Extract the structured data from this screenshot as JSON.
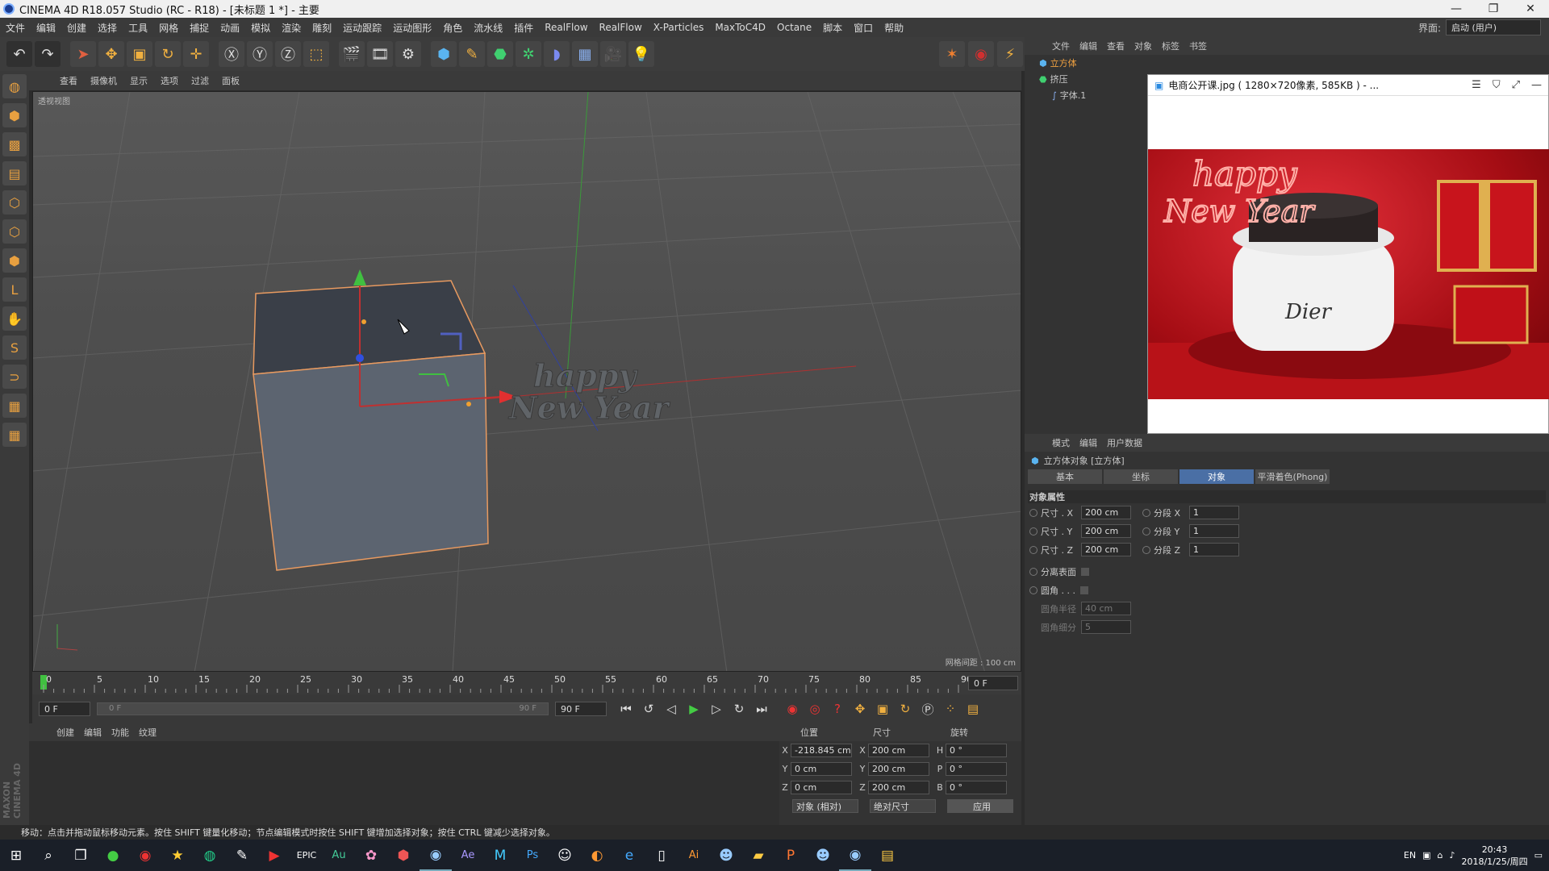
{
  "window": {
    "title": "CINEMA 4D R18.057 Studio (RC - R18) - [未标题 1 *] - 主要",
    "minimize": "—",
    "restore": "❐",
    "close": "✕"
  },
  "menu": {
    "items": [
      "文件",
      "编辑",
      "创建",
      "选择",
      "工具",
      "网格",
      "捕捉",
      "动画",
      "模拟",
      "渲染",
      "雕刻",
      "运动跟踪",
      "运动图形",
      "角色",
      "流水线",
      "插件",
      "RealFlow",
      "RealFlow",
      "X-Particles",
      "MaxToC4D",
      "Octane",
      "脚本",
      "窗口",
      "帮助"
    ],
    "layout_label": "界面:",
    "layout_value": "启动 (用户)"
  },
  "viewport": {
    "menu": [
      "查看",
      "摄像机",
      "显示",
      "选项",
      "过滤",
      "面板"
    ],
    "label": "透视视图",
    "grid_info": "网格间距 : 100 cm",
    "scene_text_1": "happy",
    "scene_text_2": "New Year"
  },
  "timeline": {
    "ticks": [
      "0",
      "5",
      "10",
      "15",
      "20",
      "25",
      "30",
      "35",
      "40",
      "45",
      "50",
      "55",
      "60",
      "65",
      "70",
      "75",
      "80",
      "85",
      "90"
    ],
    "current": "0 F",
    "start": "0 F",
    "range_start": "0 F",
    "range_end": "90 F",
    "end": "90 F"
  },
  "material": {
    "menu": [
      "创建",
      "编辑",
      "功能",
      "纹理"
    ],
    "maxon": "MAXON CINEMA 4D"
  },
  "coords": {
    "h_pos": "位置",
    "h_size": "尺寸",
    "h_rot": "旋转",
    "rows": [
      {
        "a": "X",
        "p": "-218.845 cm",
        "b": "X",
        "s": "200 cm",
        "c": "H",
        "r": "0 °"
      },
      {
        "a": "Y",
        "p": "0 cm",
        "b": "Y",
        "s": "200 cm",
        "c": "P",
        "r": "0 °"
      },
      {
        "a": "Z",
        "p": "0 cm",
        "b": "Z",
        "s": "200 cm",
        "c": "B",
        "r": "0 °"
      }
    ],
    "mode": "对象 (相对)",
    "size_mode": "绝对尺寸",
    "apply": "应用"
  },
  "status": "移动：点击并拖动鼠标移动元素。按住 SHIFT 键量化移动；节点编辑模式时按住 SHIFT 键增加选择对象；按住 CTRL 键减少选择对象。",
  "objects": {
    "menu": [
      "文件",
      "编辑",
      "查看",
      "对象",
      "标签",
      "书签"
    ],
    "items": [
      "立方体",
      "挤压",
      "字体.1"
    ]
  },
  "image_viewer": {
    "title": "电商公开课.jpg ( 1280×720像素, 585KB ) - ...",
    "text_happy": "happy",
    "text_newyear": "New Year",
    "jar_label": "Dier"
  },
  "attributes": {
    "menu": [
      "模式",
      "编辑",
      "用户数据"
    ],
    "title": "立方体对象 [立方体]",
    "tabs": [
      "基本",
      "坐标",
      "对象",
      "平滑着色(Phong)"
    ],
    "section": "对象属性",
    "size_rows": [
      {
        "l": "尺寸 . X",
        "v": "200 cm",
        "sl": "分段 X",
        "sv": "1"
      },
      {
        "l": "尺寸 . Y",
        "v": "200 cm",
        "sl": "分段 Y",
        "sv": "1"
      },
      {
        "l": "尺寸 . Z",
        "v": "200 cm",
        "sl": "分段 Z",
        "sv": "1"
      }
    ],
    "separate": "分离表面",
    "fillet": "圆角 . . .",
    "fillet_radius": "圆角半径",
    "fillet_radius_val": "40 cm",
    "fillet_sub": "圆角细分",
    "fillet_sub_val": "5"
  },
  "taskbar": {
    "time": "20:43",
    "date": "2018/1/25/周四",
    "lang": "EN"
  }
}
